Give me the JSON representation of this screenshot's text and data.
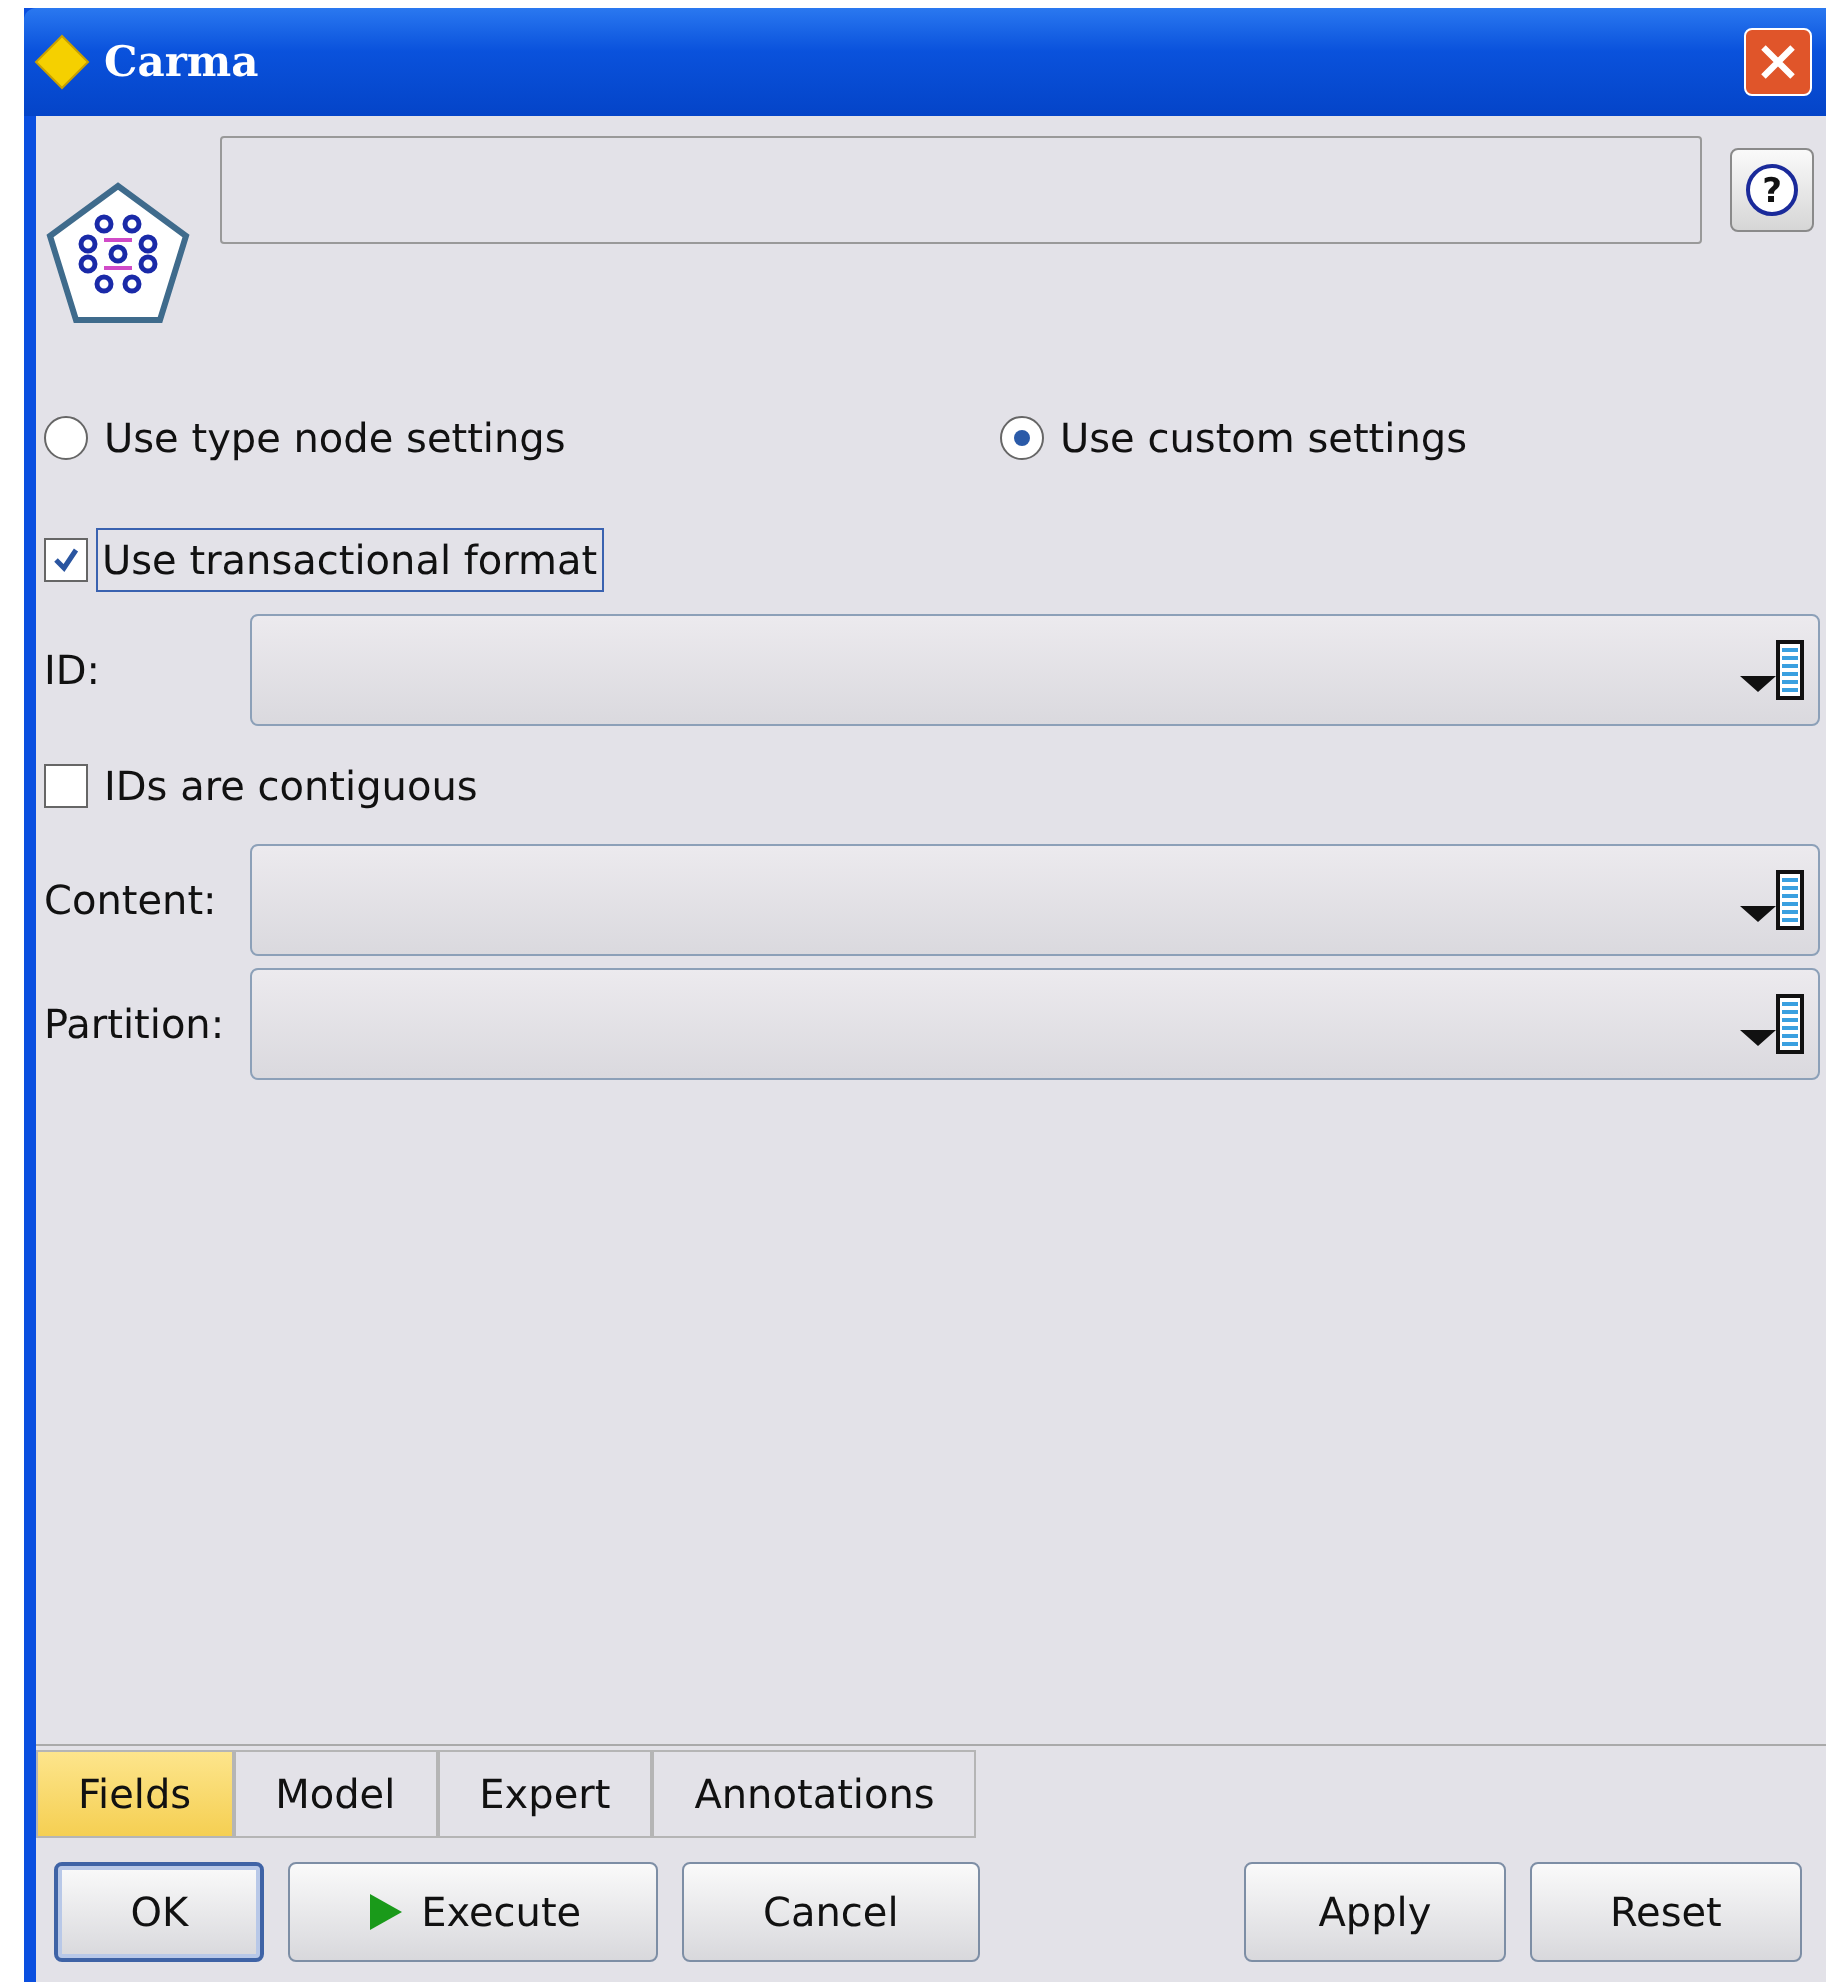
{
  "window": {
    "title": "Carma"
  },
  "help_button": {
    "label": "?"
  },
  "settings_mode": [
    {
      "label": "Use type node settings",
      "selected": false
    },
    {
      "label": "Use custom settings",
      "selected": true
    }
  ],
  "transactional": {
    "label": "Use transactional format",
    "checked": true
  },
  "fields": [
    {
      "kind": "select",
      "label": "ID:"
    },
    {
      "kind": "check",
      "label": "IDs are contiguous",
      "checked": false
    },
    {
      "kind": "select",
      "label": "Content:"
    },
    {
      "kind": "select",
      "label": "Partition:"
    }
  ],
  "tabs": [
    {
      "label": "Fields",
      "selected": true
    },
    {
      "label": "Model",
      "selected": false
    },
    {
      "label": "Expert",
      "selected": false
    },
    {
      "label": "Annotations",
      "selected": false
    }
  ],
  "buttons": [
    {
      "label": "OK",
      "kind": "default"
    },
    {
      "label": "Execute",
      "kind": "run"
    },
    {
      "label": "Cancel",
      "kind": "plain"
    },
    {
      "label": "Apply",
      "kind": "plain"
    },
    {
      "label": "Reset",
      "kind": "plain"
    }
  ]
}
